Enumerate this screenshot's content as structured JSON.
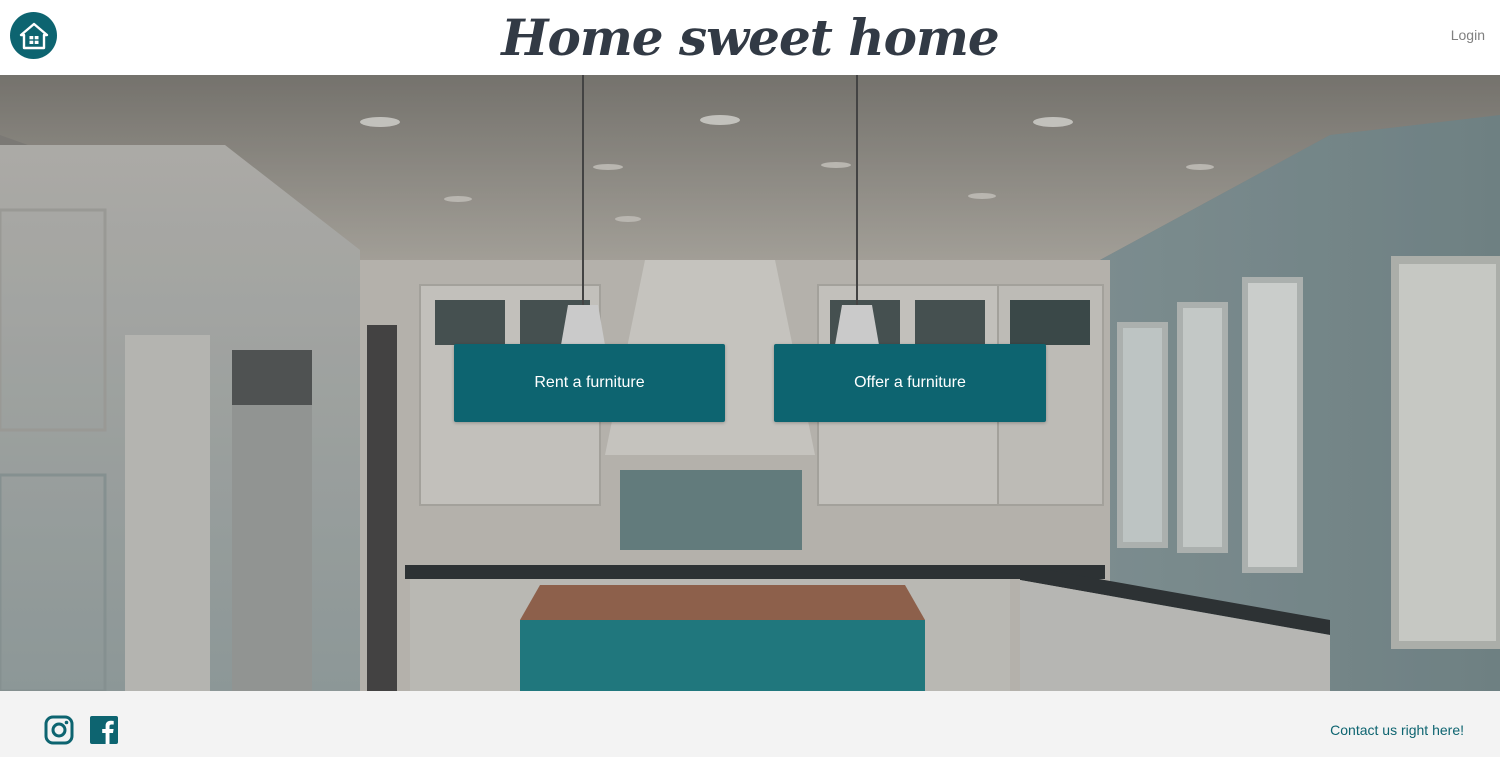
{
  "header": {
    "title": "Home sweet home",
    "login_label": "Login",
    "home_icon": "house-icon"
  },
  "hero": {
    "background": "kitchen-interior-photo",
    "buttons": [
      {
        "label": "Rent a furniture"
      },
      {
        "label": "Offer a furniture"
      }
    ]
  },
  "footer": {
    "social": [
      {
        "icon": "instagram-icon"
      },
      {
        "icon": "facebook-icon"
      }
    ],
    "contact_label": "Contact us right here!"
  },
  "colors": {
    "accent": "#0d6470",
    "title": "#323a45",
    "footer_bg": "#f3f3f3"
  }
}
